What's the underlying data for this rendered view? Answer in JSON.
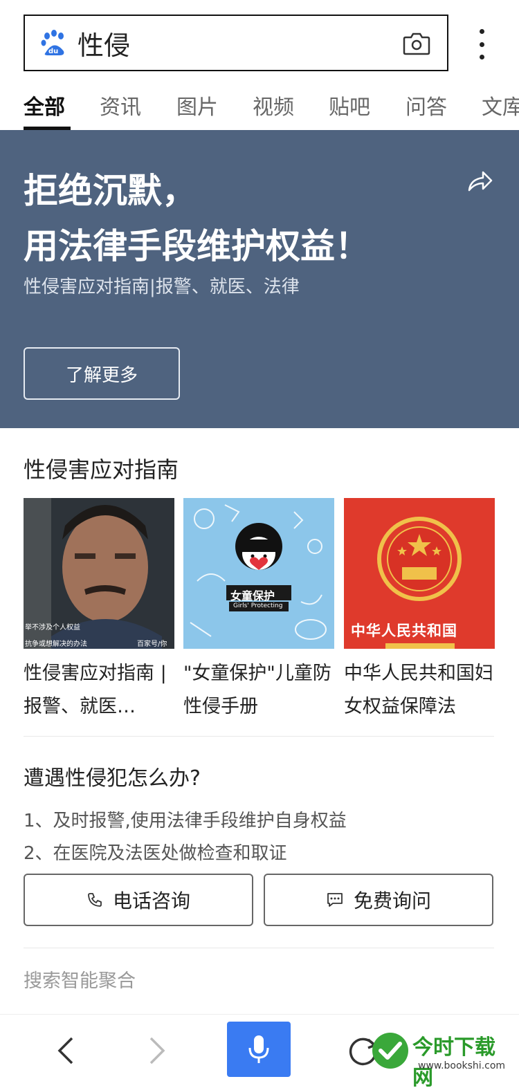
{
  "search": {
    "query": "性侵"
  },
  "tabs": [
    {
      "label": "全部"
    },
    {
      "label": "资讯"
    },
    {
      "label": "图片"
    },
    {
      "label": "视频"
    },
    {
      "label": "贴吧"
    },
    {
      "label": "问答"
    },
    {
      "label": "文库"
    }
  ],
  "banner": {
    "title_line1": "拒绝沉默，",
    "title_line2": "用法律手段维护权益！",
    "subtitle": "性侵害应对指南|报警、就医、法律",
    "button_label": "了解更多",
    "background": "#4f637f"
  },
  "guide": {
    "title": "性侵害应对指南",
    "cards": [
      {
        "caption": "性侵害应对指南 | 报警、就医…",
        "thumb_text1": "举不涉及个人权益",
        "thumb_text2": "抗争或想解决的办法",
        "thumb_source": "百家号/你"
      },
      {
        "caption": "\"女童保护\"儿童防性侵手册",
        "thumb_text1": "女童保护",
        "thumb_text2": "Girls' Protecting"
      },
      {
        "caption": "中华人民共和国妇女权益保障法",
        "thumb_text1": "中华人民共和国"
      }
    ]
  },
  "qa": {
    "title": "遭遇性侵犯怎么办?",
    "items": [
      "1、及时报警,使用法律手段维护自身权益",
      "2、在医院及法医处做检查和取证"
    ],
    "phone_label": "电话咨询",
    "ask_label": "免费询问"
  },
  "smart_label": "搜索智能聚合",
  "watermark": {
    "name": "今时下载网",
    "url": "www.bookshi.com"
  },
  "colors": {
    "accent": "#3a7bf2",
    "baidu_blue": "#2932e1",
    "banner": "#4f637f"
  }
}
